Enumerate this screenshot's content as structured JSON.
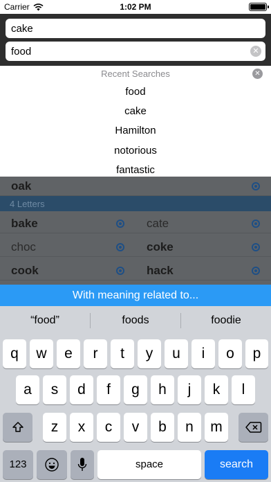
{
  "status_bar": {
    "carrier": "Carrier",
    "time": "1:02 PM"
  },
  "search": {
    "field1_value": "cake",
    "field2_value": "food",
    "clear_icon": "clear-circle-icon"
  },
  "recent": {
    "title": "Recent Searches",
    "items": [
      "food",
      "cake",
      "Hamilton",
      "notorious",
      "fantastic"
    ]
  },
  "results": {
    "top_row_word": "oak",
    "section_header": "4 Letters",
    "rows": [
      {
        "left": "bake",
        "right": "cate"
      },
      {
        "left": "choc",
        "right": "coke"
      },
      {
        "left": "cook",
        "right": "hack"
      }
    ]
  },
  "banner": {
    "label": "With meaning related to..."
  },
  "keyboard": {
    "suggestions": [
      "“food”",
      "foods",
      "foodie"
    ],
    "row1": [
      "q",
      "w",
      "e",
      "r",
      "t",
      "y",
      "u",
      "i",
      "o",
      "p"
    ],
    "row2": [
      "a",
      "s",
      "d",
      "f",
      "g",
      "h",
      "j",
      "k",
      "l"
    ],
    "row3": [
      "z",
      "x",
      "c",
      "v",
      "b",
      "n",
      "m"
    ],
    "numbers_label": "123",
    "space_label": "space",
    "search_label": "search",
    "shift_icon": "shift-icon",
    "delete_icon": "delete-icon",
    "emoji_icon": "emoji-icon",
    "mic_icon": "microphone-icon"
  }
}
